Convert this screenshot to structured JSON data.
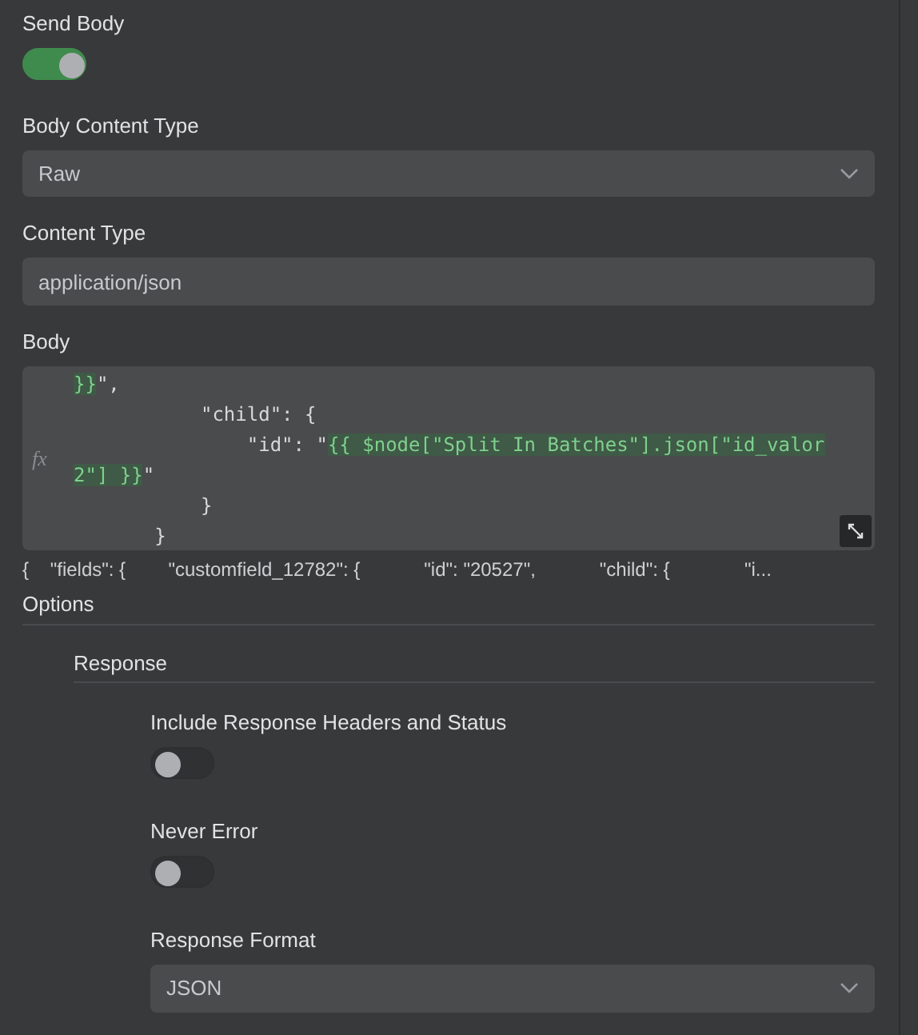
{
  "send_body": {
    "label": "Send Body",
    "on": true
  },
  "body_content_type": {
    "label": "Body Content Type",
    "value": "Raw"
  },
  "content_type": {
    "label": "Content Type",
    "value": "application/json"
  },
  "body": {
    "label": "Body",
    "code_lines": [
      {
        "segments": [
          {
            "kind": "expr",
            "text": "}}"
          },
          {
            "kind": "plain",
            "text": "\","
          }
        ]
      },
      {
        "segments": [
          {
            "kind": "plain",
            "text": "           \"child\": {"
          }
        ]
      },
      {
        "segments": [
          {
            "kind": "plain",
            "text": "               \"id\": \""
          },
          {
            "kind": "expr",
            "text": "{{ $node[\"Split In Batches\"].json[\"id_valor"
          }
        ]
      },
      {
        "segments": [
          {
            "kind": "expr",
            "text": "2\"] }}"
          },
          {
            "kind": "plain",
            "text": "\""
          }
        ]
      },
      {
        "segments": [
          {
            "kind": "plain",
            "text": "           }"
          }
        ]
      },
      {
        "segments": [
          {
            "kind": "plain",
            "text": "       }"
          }
        ]
      }
    ],
    "fx_label": "fx",
    "preview": "{    \"fields\": {        \"customfield_12782\": {            \"id\": \"20527\",            \"child\": {              \"i..."
  },
  "options": {
    "label": "Options",
    "section": "Response",
    "items": [
      {
        "kind": "toggle",
        "label": "Include Response Headers and Status",
        "on": false
      },
      {
        "kind": "toggle",
        "label": "Never Error",
        "on": false
      },
      {
        "kind": "select",
        "label": "Response Format",
        "value": "JSON"
      }
    ]
  }
}
